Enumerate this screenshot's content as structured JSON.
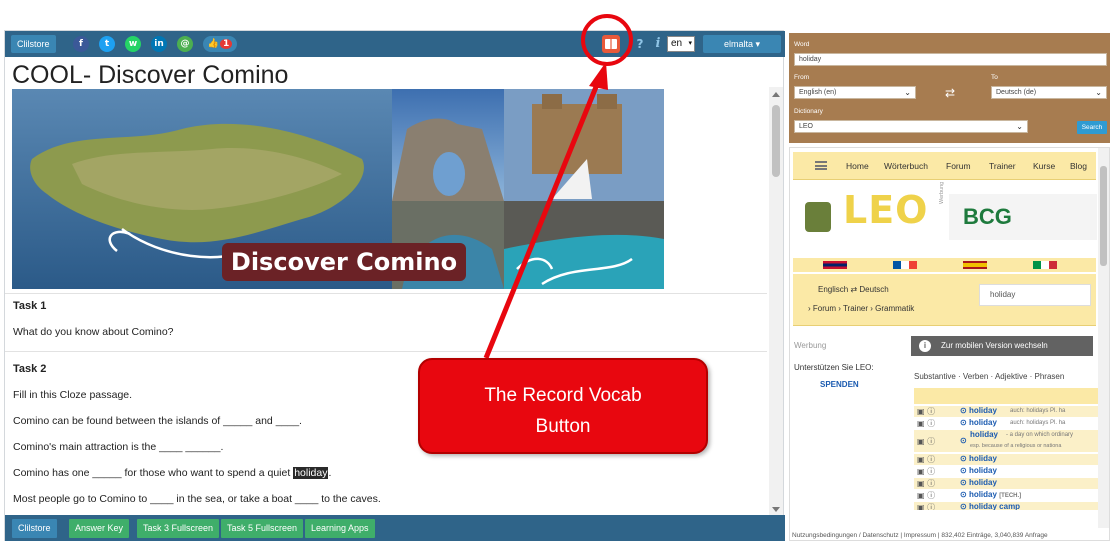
{
  "toolbar": {
    "clilstore_label": "Clilstore",
    "social": {
      "facebook": "f",
      "twitter": "t",
      "whatsapp": "w",
      "linkedin": "in",
      "email": "@",
      "likes_count": "1"
    },
    "language_value": "en",
    "user_label": "elmalta ▾"
  },
  "page": {
    "title": "COOL- Discover Comino",
    "hero_caption": "Discover Comino"
  },
  "tasks": {
    "task1_heading": "Task 1",
    "task1_text": "What do you know about Comino?",
    "task2_heading": "Task 2",
    "task2_intro": "Fill in this Cloze passage.",
    "line1": "Comino can be found between the islands of _____ and ____.",
    "line2": "Comino's main attraction is the ____ ______.",
    "line3_before": "Comino has one _____ for those who want to spend a quiet",
    "line3_highlight": "holiday",
    "line3_after": ".",
    "line4": "Most people go to Comino to ____ in the sea, or take a boat ____ to the caves."
  },
  "bottom_bar": {
    "clilstore": "Clilstore",
    "answer_key": "Answer Key",
    "task3": "Task 3 Fullscreen",
    "task5": "Task 5 Fullscreen",
    "learning_apps": "Learning Apps"
  },
  "dictionary_panel": {
    "word_label": "Word",
    "word_value": "holiday",
    "from_label": "From",
    "to_label": "To",
    "from_value": "English (en)",
    "to_value": "Deutsch (de)",
    "dictionary_label": "Dictionary",
    "dictionary_value": "LEO",
    "search_label": "Search"
  },
  "leo": {
    "nav": [
      "Home",
      "Wörterbuch",
      "Forum",
      "Trainer",
      "Kurse",
      "Blog"
    ],
    "logo": "LEO",
    "ad_vertical": "Werbung",
    "bcg": "BCG",
    "lang_pair": "Englisch ⇄ Deutsch",
    "breadcrumb": "› Forum › Trainer › Grammatik",
    "search_value": "holiday",
    "werbung": "Werbung",
    "mobile_button": "Zur mobilen Version wechseln",
    "support": "Unterstützen Sie LEO:",
    "spenden": "SPENDEN",
    "pos_tabs": "Substantive · Verben · Adjektive · Phrasen",
    "results": [
      {
        "word": "holiday",
        "extra": "auch: holidays  Pl.  ha"
      },
      {
        "word": "holiday",
        "extra": "auch: holidays  Pl.  ha"
      },
      {
        "word": "holiday",
        "extra": "- a day on which ordinary",
        "sub": "esp. because of a religious or nationa"
      },
      {
        "word": "holiday",
        "extra": ""
      },
      {
        "word": "holiday",
        "extra": ""
      },
      {
        "word": "holiday",
        "extra": ""
      },
      {
        "word": "holiday",
        "extra": "[TECH.]"
      },
      {
        "word": "holiday camp",
        "extra": ""
      }
    ],
    "footer": "Nutzungsbedingungen / Datenschutz | Impressum | 832,402 Einträge, 3,040,839 Anfrage"
  },
  "annotation": {
    "callout_line1": "The Record Vocab",
    "callout_line2": "Button"
  },
  "colors": {
    "toolbar_blue": "#2f6489",
    "button_green": "#3fae6a",
    "leo_yellow": "#fbe9a6",
    "dict_panel_brown": "#a77c50",
    "annotation_red": "#e8070f"
  }
}
